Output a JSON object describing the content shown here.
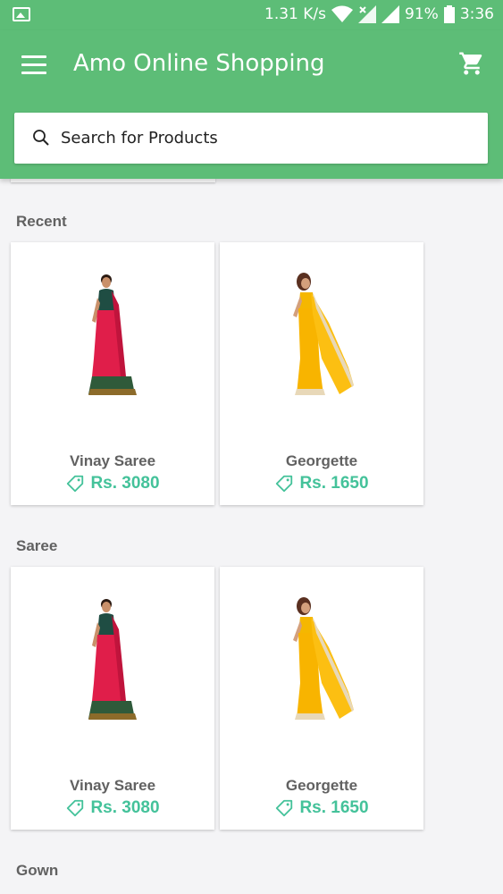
{
  "status_bar": {
    "speed": "1.31 K/s",
    "battery": "91%",
    "time": "3:36"
  },
  "app_bar": {
    "title": "Amo Online Shopping"
  },
  "search": {
    "placeholder": "Search for Products"
  },
  "sections": [
    {
      "title": "Recent",
      "products": [
        {
          "name": "Vinay Saree",
          "price": "Rs. 3080",
          "image": "red-saree"
        },
        {
          "name": "Georgette",
          "price": "Rs. 1650",
          "image": "yellow-saree"
        }
      ]
    },
    {
      "title": "Saree",
      "products": [
        {
          "name": "Vinay Saree",
          "price": "Rs. 3080",
          "image": "red-saree"
        },
        {
          "name": "Georgette",
          "price": "Rs. 1650",
          "image": "yellow-saree"
        }
      ]
    },
    {
      "title": "Gown",
      "products": []
    }
  ],
  "colors": {
    "primary": "#5dbd77",
    "price": "#44c29a",
    "text_gray": "#616161",
    "background": "#f4f4f6"
  }
}
